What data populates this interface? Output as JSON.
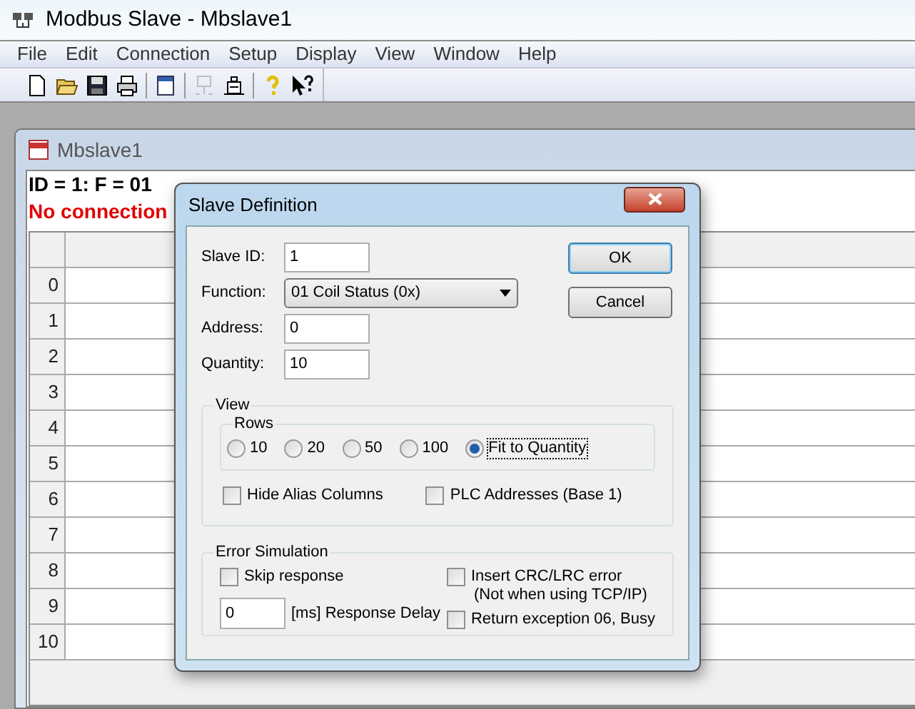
{
  "window": {
    "title": "Modbus Slave - Mbslave1"
  },
  "menu": [
    "File",
    "Edit",
    "Connection",
    "Setup",
    "Display",
    "View",
    "Window",
    "Help"
  ],
  "toolbar": [
    {
      "kind": "new",
      "disabled": false
    },
    {
      "kind": "open",
      "disabled": false
    },
    {
      "kind": "save",
      "disabled": false
    },
    {
      "kind": "print",
      "disabled": false
    },
    {
      "kind": "window",
      "disabled": false
    },
    {
      "kind": "connect",
      "disabled": true
    },
    {
      "kind": "disconnect",
      "disabled": false
    },
    {
      "kind": "help",
      "disabled": false
    },
    {
      "kind": "context_help",
      "disabled": false
    }
  ],
  "child_window": {
    "title": "Mbslave1",
    "id_line": "ID = 1: F = 01",
    "status": "No connection",
    "row_numbers": [
      "0",
      "1",
      "2",
      "3",
      "4",
      "5",
      "6",
      "7",
      "8",
      "9",
      "10"
    ]
  },
  "dialog": {
    "title": "Slave Definition",
    "fields": [
      {
        "label": "Slave ID:",
        "value": "1",
        "kind": "text"
      },
      {
        "label": "Function:",
        "value": "01 Coil Status (0x)",
        "kind": "dropdown"
      },
      {
        "label": "Address:",
        "value": "0",
        "kind": "text"
      },
      {
        "label": "Quantity:",
        "value": "10",
        "kind": "text"
      }
    ],
    "buttons": [
      {
        "label": "OK",
        "default": true
      },
      {
        "label": "Cancel",
        "default": false
      }
    ],
    "view": {
      "title": "View",
      "rows_title": "Rows",
      "rows_options": [
        {
          "label": "10",
          "selected": false
        },
        {
          "label": "20",
          "selected": false
        },
        {
          "label": "50",
          "selected": false
        },
        {
          "label": "100",
          "selected": false
        },
        {
          "label": "Fit to Quantity",
          "selected": true
        }
      ],
      "checkboxes": [
        {
          "label": "Hide Alias Columns",
          "checked": false
        },
        {
          "label": "PLC Addresses (Base 1)",
          "checked": false
        }
      ]
    },
    "error_simulation": {
      "title": "Error Simulation",
      "skip_response": {
        "label": "Skip response",
        "checked": false
      },
      "delay": {
        "value": "0",
        "label": "[ms] Response Delay"
      },
      "insert_crc": {
        "label": "Insert CRC/LRC error",
        "note": "(Not when using TCP/IP)",
        "checked": false
      },
      "return_exception": {
        "label": "Return exception 06, Busy",
        "checked": false
      }
    }
  }
}
